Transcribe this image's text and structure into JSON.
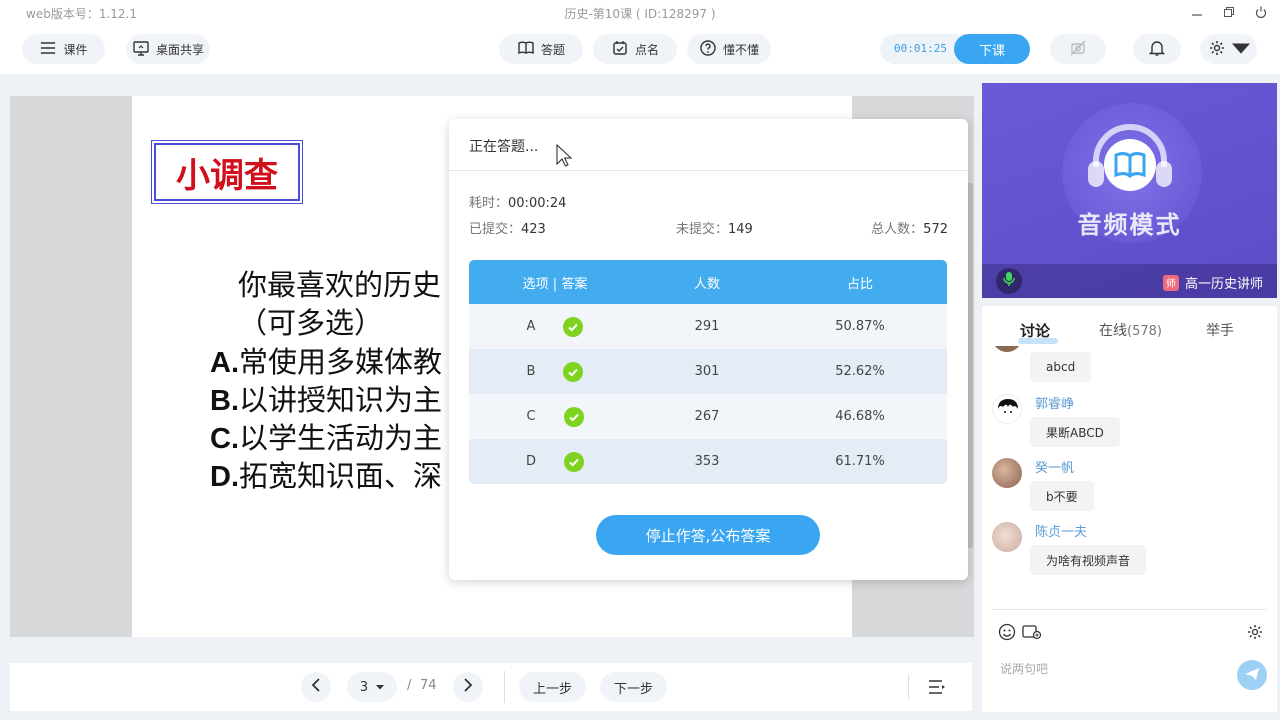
{
  "window": {
    "version": "web版本号：1.12.1",
    "title": "历史-第10课 ( ID:128297 )"
  },
  "toolbar": {
    "courseware": "课件",
    "screen_share": "桌面共享",
    "answer": "答题",
    "roll_call": "点名",
    "understand": "懂不懂",
    "timer": "00:01:25",
    "end_class": "下课"
  },
  "slide": {
    "title": "小调查",
    "question_line1": "你最喜欢的历史",
    "question_line2": "（可多选）",
    "options": [
      {
        "letter": "A.",
        "text": "常使用多媒体教"
      },
      {
        "letter": "B.",
        "text": "以讲授知识为主"
      },
      {
        "letter": "C.",
        "text": "以学生活动为主"
      },
      {
        "letter": "D.",
        "text": "拓宽知识面、深"
      }
    ]
  },
  "panel": {
    "status": "正在答题...",
    "elapsed_label": "耗时：",
    "elapsed": "00:00:24",
    "submitted_label": "已提交：",
    "submitted": "423",
    "unsubmitted_label": "未提交：",
    "unsubmitted": "149",
    "total_label": "总人数：",
    "total": "572",
    "headers": [
      "选项 | 答案",
      "人数",
      "占比"
    ],
    "rows": [
      {
        "option": "A",
        "count": "291",
        "percent": "50.87%"
      },
      {
        "option": "B",
        "count": "301",
        "percent": "52.62%"
      },
      {
        "option": "C",
        "count": "267",
        "percent": "46.68%"
      },
      {
        "option": "D",
        "count": "353",
        "percent": "61.71%"
      }
    ],
    "stop_button": "停止作答,公布答案"
  },
  "pager": {
    "current": "3",
    "separator": "/",
    "total": "74",
    "prev_step": "上一步",
    "next_step": "下一步"
  },
  "video": {
    "mode": "音频模式",
    "teacher_tag": "师",
    "teacher": "高一历史讲师"
  },
  "chat": {
    "tabs": {
      "discuss": "讨论",
      "online": "在线",
      "online_count": "(578)",
      "raise_hand": "举手"
    },
    "messages": [
      {
        "name": "",
        "text": "abcd"
      },
      {
        "name": "郭睿峥",
        "text": "果断ABCD"
      },
      {
        "name": "癸一帆",
        "text": "b不要"
      },
      {
        "name": "陈贞一夫",
        "text": "为啥有视频声音"
      }
    ],
    "input_placeholder": "说两句吧"
  },
  "colors": {
    "accent": "#3aa6f2",
    "check": "#7ed321",
    "title_red": "#d10f1b"
  }
}
